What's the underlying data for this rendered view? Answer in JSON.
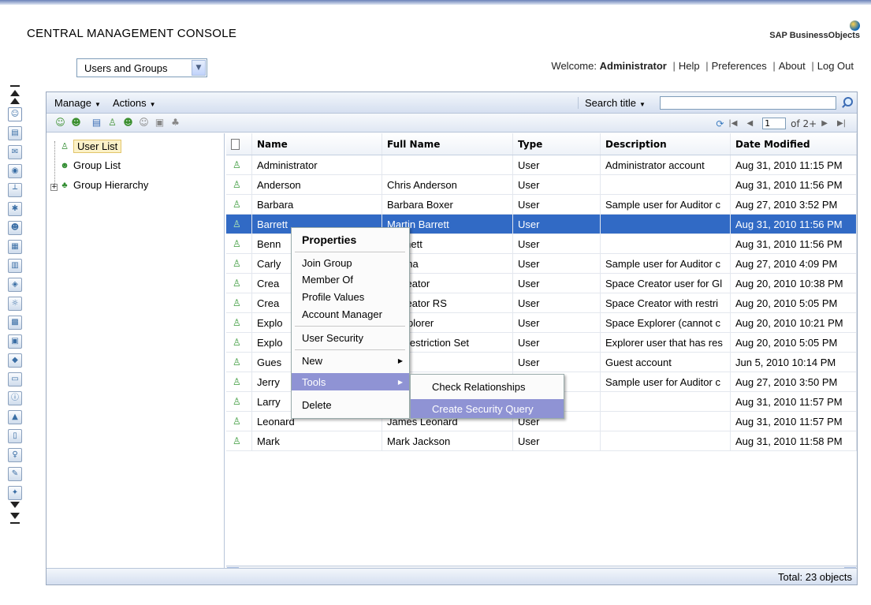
{
  "app": {
    "title": "CENTRAL MANAGEMENT CONSOLE",
    "logo_text": "SAP BusinessObjects",
    "accent": "#316ac5"
  },
  "nav": {
    "selected": "Users and Groups"
  },
  "header": {
    "welcome_prefix": "Welcome:",
    "user": "Administrator",
    "links": [
      "Help",
      "Preferences",
      "About",
      "Log Out"
    ]
  },
  "menubar": {
    "manage": "Manage",
    "actions": "Actions",
    "search_label": "Search title",
    "search_value": ""
  },
  "pager": {
    "page": "1",
    "of": "of 2+"
  },
  "tree": {
    "items": [
      {
        "label": "User List",
        "icon": "user-icon"
      },
      {
        "label": "Group List",
        "icon": "group-icon"
      },
      {
        "label": "Group Hierarchy",
        "icon": "hierarchy-icon"
      }
    ]
  },
  "grid": {
    "columns": [
      "Name",
      "Full Name",
      "Type",
      "Description",
      "Date Modified"
    ],
    "rows": [
      [
        "Administrator",
        "",
        "User",
        "Administrator account",
        "Aug 31, 2010 11:15 PM"
      ],
      [
        "Anderson",
        "Chris Anderson",
        "User",
        "",
        "Aug 31, 2010 11:56 PM"
      ],
      [
        "Barbara",
        "Barbara Boxer",
        "User",
        "Sample user for Auditor c",
        "Aug 27, 2010 3:52 PM"
      ],
      [
        "Barrett",
        "Martin Barrett",
        "User",
        "",
        "Aug 31, 2010 11:56 PM"
      ],
      [
        "Benn",
        "Bennett",
        "User",
        "",
        "Aug 31, 2010 11:56 PM"
      ],
      [
        "Carly",
        "Fiorina",
        "User",
        "Sample user for Auditor c",
        "Aug 27, 2010 4:09 PM"
      ],
      [
        "Crea",
        "e Creator",
        "User",
        "Space Creator user for Gl",
        "Aug 20, 2010 10:38 PM"
      ],
      [
        "Crea",
        "e Creator RS",
        "User",
        "Space Creator with restri",
        "Aug 20, 2010 5:05 PM"
      ],
      [
        "Explo",
        "e Explorer",
        "User",
        "Space Explorer (cannot c",
        "Aug 20, 2010 10:21 PM"
      ],
      [
        "Explo",
        "rer Restriction Set",
        "User",
        "Explorer user that has res",
        "Aug 20, 2010 5:05 PM"
      ],
      [
        "Gues",
        "",
        "User",
        "Guest account",
        "Jun 5, 2010 10:14 PM"
      ],
      [
        "Jerry",
        "",
        "User",
        "Sample user for Auditor c",
        "Aug 27, 2010 3:50 PM"
      ],
      [
        "Larry",
        "",
        "",
        "",
        "Aug 31, 2010 11:57 PM"
      ],
      [
        "Leonard",
        "James Leonard",
        "User",
        "",
        "Aug 31, 2010 11:57 PM"
      ],
      [
        "Mark",
        "Mark Jackson",
        "User",
        "",
        "Aug 31, 2010 11:58 PM"
      ]
    ],
    "selected_row": 3
  },
  "status": {
    "total": "Total: 23 objects"
  },
  "context_menu": {
    "items": [
      "Properties",
      "Join Group",
      "Member Of",
      "Profile Values",
      "Account Manager",
      "User Security",
      "New",
      "Tools",
      "Delete"
    ],
    "highlighted": "Tools"
  },
  "submenu": {
    "items": [
      "Check Relationships",
      "Create Security Query"
    ],
    "highlighted": "Create Security Query"
  }
}
